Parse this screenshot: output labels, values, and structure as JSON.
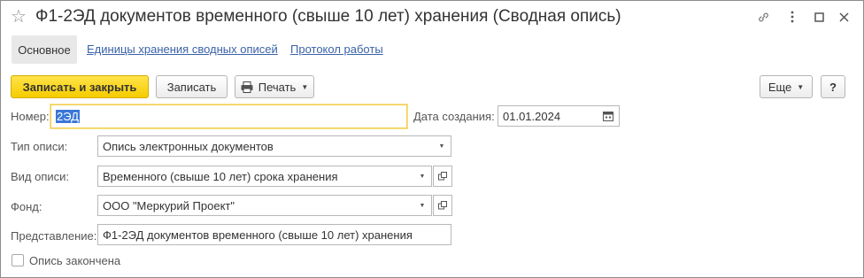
{
  "window": {
    "title": "Ф1-2ЭД документов временного (свыше 10 лет) хранения (Сводная опись)",
    "favorite_icon": "star-icon",
    "link_icon": "link-icon",
    "more_icon": "more-vertical-icon",
    "maximize_icon": "maximize-icon",
    "close_icon": "close-icon"
  },
  "tabs": [
    {
      "label": "Основное"
    },
    {
      "label": "Единицы хранения сводных описей"
    },
    {
      "label": "Протокол работы"
    }
  ],
  "toolbar": {
    "save_close_label": "Записать и закрыть",
    "save_label": "Записать",
    "print_label": "Печать",
    "more_label": "Еще",
    "help_label": "?"
  },
  "form": {
    "number": {
      "label": "Номер:",
      "value": "2ЭД"
    },
    "created_date": {
      "label": "Дата создания:",
      "value": "01.01.2024"
    },
    "inventory_type": {
      "label": "Тип описи:",
      "value": "Опись электронных документов"
    },
    "inventory_kind": {
      "label": "Вид описи:",
      "value": "Временного (свыше 10 лет) срока хранения"
    },
    "fund": {
      "label": "Фонд:",
      "value": "ООО \"Меркурий Проект\""
    },
    "presentation": {
      "label": "Представление:",
      "value": "Ф1-2ЭД документов временного (свыше 10 лет) хранения"
    },
    "finished": {
      "label": "Опись закончена",
      "checked": false
    }
  }
}
